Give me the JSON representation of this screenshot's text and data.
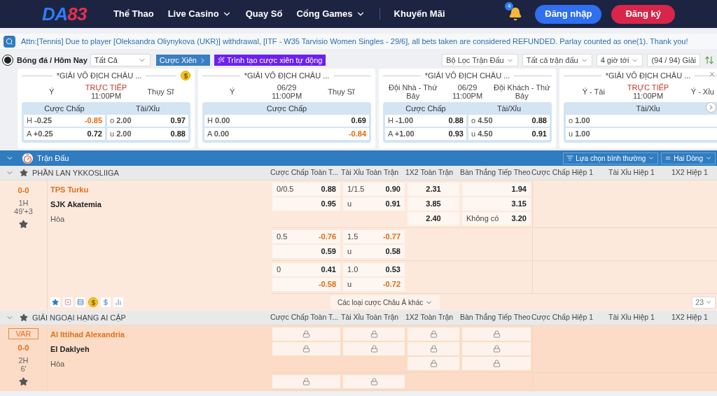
{
  "header": {
    "logo": [
      "DA",
      "83"
    ],
    "nav": [
      {
        "label": "Thể Thao",
        "dropdown": false
      },
      {
        "label": "Live Casino",
        "dropdown": true
      },
      {
        "label": "Quay Số",
        "dropdown": false
      },
      {
        "label": "Cổng Games",
        "dropdown": true
      },
      {
        "label": "Khuyến Mãi",
        "dropdown": false
      }
    ],
    "notification_count": "4",
    "login": "Đăng nhập",
    "register": "Đăng ký"
  },
  "notice": "Attn:[Tennis] Due to player [Oleksandra Oliynykova (UKR)] withdrawal, [ITF - W35 Tarvisio Women Singles - 29/6], all bets taken are considered REFUNDED. Parlay counted as one(1). Thank you!",
  "filter_bar": {
    "sport": "Bóng đá / Hôm Nay",
    "select": "Tất Cả",
    "parlay": "Cược Xiên",
    "parlay_builder": "Trình tạo cược xiên tự động",
    "filters": [
      "Bộ Lọc Trận Đấu",
      "Tất cả trận đấu",
      "4 giờ tới"
    ],
    "league_count": "(94 / 94) Giải"
  },
  "featured": [
    {
      "title": "*GIẢI VÔ ĐỊCH CHÂU ...",
      "coin": true,
      "home": "Ý",
      "status": "TRỰC TIẾP",
      "live": true,
      "time": "11:00PM",
      "away": "Thụy Sĩ",
      "markets": [
        {
          "title": "Cược Chấp",
          "rows": [
            {
              "label": "H **-0.25**",
              "odds": "-0.85",
              "negative": true
            },
            {
              "label": "A **+0.25**",
              "odds": "0.72",
              "negative": false
            }
          ]
        },
        {
          "title": "Tài/Xỉu",
          "rows": [
            {
              "label": "o **2.00**",
              "odds": "0.97",
              "negative": false
            },
            {
              "label": "u **2.00**",
              "odds": "0.88",
              "negative": false
            }
          ]
        }
      ]
    },
    {
      "title": "*GIẢI VÔ ĐỊCH CHÂU ...",
      "coin": false,
      "home": "Ý",
      "status": "06/29",
      "live": false,
      "time": "11:00PM",
      "away": "Thụy Sĩ",
      "markets": [
        {
          "title": "Cược Chấp",
          "rows": [
            {
              "label": "H **0.00**",
              "odds": "0.69",
              "negative": false
            },
            {
              "label": "A **0.00**",
              "odds": "-0.84",
              "negative": true
            }
          ]
        }
      ]
    },
    {
      "title": "*GIẢI VÔ ĐỊCH CHÂU ...",
      "coin": false,
      "home": "Đội Nhà - Thứ Bảy",
      "status": "06/29",
      "live": false,
      "time": "11:00PM",
      "away": "Đội Khách - Thứ Bảy",
      "markets": [
        {
          "title": "Cược Chấp",
          "rows": [
            {
              "label": "H **-1.00**",
              "odds": "0.88",
              "negative": false
            },
            {
              "label": "A **+1.00**",
              "odds": "0.93",
              "negative": false
            }
          ]
        },
        {
          "title": "Tài/Xỉu",
          "rows": [
            {
              "label": "o **4.50**",
              "odds": "0.88",
              "negative": false
            },
            {
              "label": "u **4.50**",
              "odds": "0.91",
              "negative": false
            }
          ]
        }
      ]
    },
    {
      "title": "*GIẢI VÔ ĐỊCH CHÂU ...",
      "coin": false,
      "home": "Ý - Tài",
      "status": "TRỰC TIẾP",
      "live": true,
      "time": "11:00PM",
      "away": "Ý - Xỉu",
      "markets": [
        {
          "title": "Tài/Xỉu",
          "rows": [
            {
              "label": "o **1.00**"
            },
            {
              "label": "u **1.00**"
            }
          ]
        }
      ]
    }
  ],
  "section": {
    "title": "Trận Đấu",
    "options": [
      "Lựa chọn bình thường",
      "Hai Dòng"
    ]
  },
  "leagues": [
    {
      "name": "PHẦN LAN YKKOSLIIGA",
      "columns": [
        "Cược Chấp Toàn T...",
        "Tài Xỉu Toàn Trận",
        "1X2 Toàn Trận",
        "Bàn Thắng Tiếp Theo",
        "Cược Chấp Hiệp 1",
        "Tài Xỉu Hiệp 1",
        "1X2 Hiệp 1"
      ],
      "match": {
        "var": false,
        "score": "0-0",
        "period": "1H",
        "clock": "49'+3",
        "home": "TPS Turku",
        "away": "SJK Akatemia",
        "draw": "Hòa",
        "lines": [
          {
            "handicap": [
              {
                "label": "0/0.5",
                "odds": "0.88",
                "negative": false
              },
              {
                "odds": "0.95",
                "negative": false
              }
            ],
            "over_under": [
              {
                "label": "1/1.5",
                "odds": "0.90",
                "negative": false
              },
              {
                "label": "u",
                "odds": "0.91",
                "negative": false
              }
            ],
            "x12": [
              {
                "odds": "2.31",
                "negative": false
              },
              {
                "odds": "3.85",
                "negative": false
              },
              {
                "odds": "2.40",
                "negative": false
              }
            ],
            "next_goal": [
              {
                "odds": "1.94",
                "negative": false
              },
              {
                "odds": "3.15",
                "negative": false
              },
              {
                "label": "Không có",
                "odds": "3.20",
                "negative": false
              }
            ]
          },
          {
            "handicap": [
              {
                "label": "0.5",
                "odds": "-0.76",
                "negative": true
              },
              {
                "odds": "0.59",
                "negative": false
              }
            ],
            "over_under": [
              {
                "label": "1.5",
                "odds": "-0.77",
                "negative": true
              },
              {
                "label": "u",
                "odds": "0.58",
                "negative": false
              }
            ]
          },
          {
            "handicap": [
              {
                "label": "0",
                "odds": "0.41",
                "negative": false
              },
              {
                "odds": "-0.58",
                "negative": true
              }
            ],
            "over_under": [
              {
                "label": "1.0",
                "odds": "0.53",
                "negative": false
              },
              {
                "label": "u",
                "odds": "-0.72",
                "negative": true
              }
            ]
          }
        ],
        "more_bets": "Các loại cược Châu Á khác",
        "count": "23"
      }
    },
    {
      "name": "GIẢI NGOẠI HẠNG AI CẬP",
      "columns": [
        "Cược Chấp Toàn T...",
        "Tài Xỉu Toàn Trận",
        "1X2 Toàn Trận",
        "Bàn Thắng Tiếp Theo",
        "Cược Chấp Hiệp 1",
        "Tài Xỉu Hiệp 1",
        "1X2 Hiệp 1"
      ],
      "match": {
        "var": true,
        "var_label": "VAR",
        "score": "0-0",
        "period": "2H",
        "clock": "6'",
        "home": "Al Ittihad Alexandria",
        "away": "El Daklyeh",
        "draw": "Hòa",
        "lines": [
          {
            "handicap": [
              {
                "locked": true
              },
              {
                "locked": true
              }
            ],
            "over_under": [
              {
                "locked": true
              },
              {
                "locked": true
              }
            ],
            "x12": [
              {
                "locked": true
              },
              {
                "locked": true
              },
              {
                "locked": true
              }
            ],
            "next_goal": [
              {
                "locked": true
              },
              {
                "locked": true
              },
              {
                "locked": true
              }
            ]
          },
          {
            "handicap": [
              {
                "locked": true
              }
            ],
            "over_under": [
              {
                "locked": true
              }
            ]
          }
        ]
      }
    }
  ]
}
